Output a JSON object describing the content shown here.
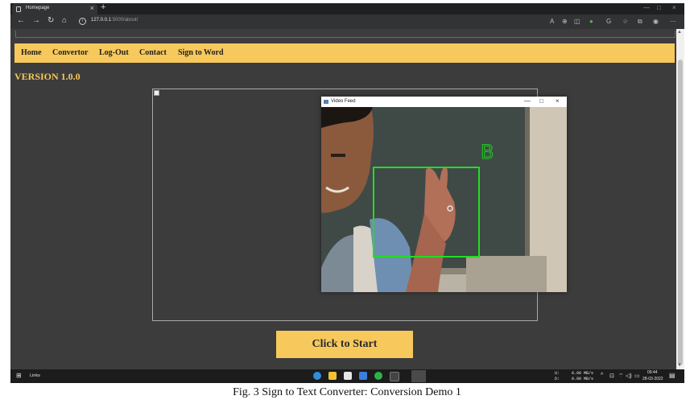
{
  "browser": {
    "tab_title": "Homepage",
    "tab_close": "×",
    "new_tab": "+",
    "url_host": "127.0.0.1",
    "url_rest": ":5000/about/",
    "window_controls": [
      "—",
      "□",
      "×"
    ]
  },
  "navbar": {
    "items": [
      "Home",
      "Convertor",
      "Log-Out",
      "Contact",
      "Sign to Word"
    ]
  },
  "version": "VERSION 1.0.0",
  "start_button": "Click to Start",
  "video_window": {
    "title": "Video Feed",
    "controls": [
      "—",
      "□",
      "×"
    ],
    "detected_letter": "B"
  },
  "taskbar": {
    "links_label": "Links",
    "net_up_label": "U:",
    "net_down_label": "D:",
    "net_up": "0.00 MB/s",
    "net_down": "0.00 MB/s",
    "time": "09:44",
    "date": "28-03-2022"
  },
  "caption": "Fig. 3 Sign to Text Converter: Conversion Demo 1",
  "colors": {
    "accent": "#f7c95c",
    "page_bg": "#3c3c3c",
    "detect_box": "#22dd22"
  }
}
